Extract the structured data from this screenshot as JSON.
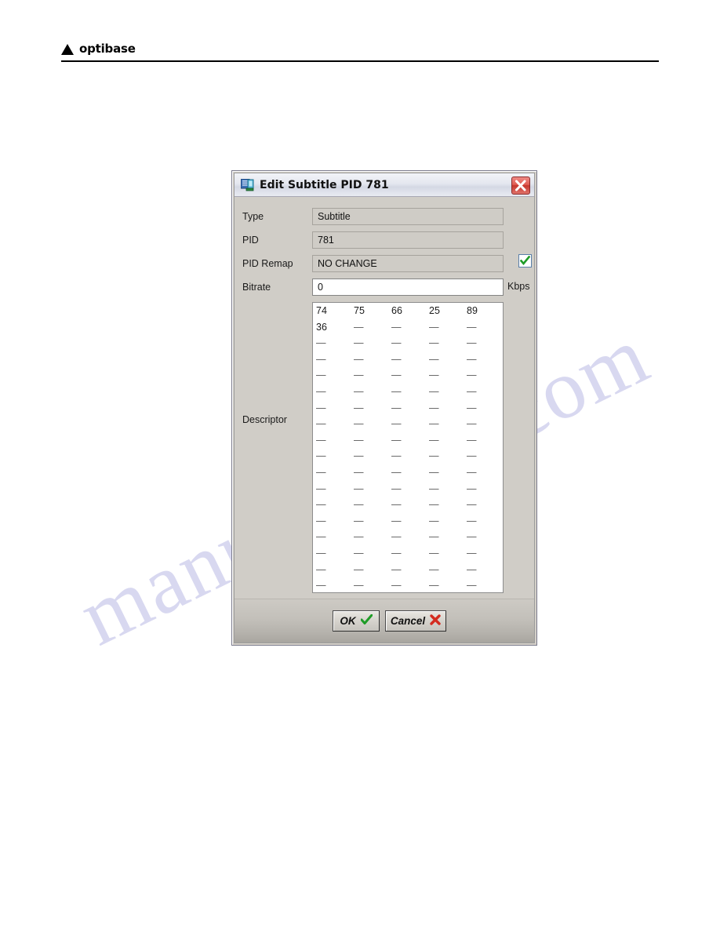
{
  "page": {
    "brand": "optibase",
    "watermark_line1": "manualshive.com",
    "watermark_line2": ""
  },
  "dialog": {
    "title": "Edit Subtitle PID 781",
    "title_icon": "computer-icon",
    "close_icon": "close-icon",
    "fields": {
      "type": {
        "label": "Type",
        "value": "Subtitle",
        "readonly": true
      },
      "pid": {
        "label": "PID",
        "value": "781",
        "readonly": true
      },
      "pid_remap": {
        "label": "PID Remap",
        "value": "NO CHANGE",
        "readonly": true,
        "checkbox_checked": true
      },
      "bitrate": {
        "label": "Bitrate",
        "value": "0",
        "readonly": false,
        "unit": "Kbps",
        "placeholder": ""
      }
    },
    "descriptor": {
      "label": "Descriptor",
      "columns": 5,
      "rows": [
        [
          "74",
          "75",
          "66",
          "25",
          "89"
        ],
        [
          "36",
          "—",
          "—",
          "—",
          "—"
        ],
        [
          "—",
          "—",
          "—",
          "—",
          "—"
        ],
        [
          "—",
          "—",
          "—",
          "—",
          "—"
        ],
        [
          "—",
          "—",
          "—",
          "—",
          "—"
        ],
        [
          "—",
          "—",
          "—",
          "—",
          "—"
        ],
        [
          "—",
          "—",
          "—",
          "—",
          "—"
        ],
        [
          "—",
          "—",
          "—",
          "—",
          "—"
        ],
        [
          "—",
          "—",
          "—",
          "—",
          "—"
        ],
        [
          "—",
          "—",
          "—",
          "—",
          "—"
        ],
        [
          "—",
          "—",
          "—",
          "—",
          "—"
        ],
        [
          "—",
          "—",
          "—",
          "—",
          "—"
        ],
        [
          "—",
          "—",
          "—",
          "—",
          "—"
        ],
        [
          "—",
          "—",
          "—",
          "—",
          "—"
        ],
        [
          "—",
          "—",
          "—",
          "—",
          "—"
        ],
        [
          "—",
          "—",
          "—",
          "—",
          "—"
        ],
        [
          "—",
          "—",
          "—",
          "—",
          "—"
        ],
        [
          "—",
          "—",
          "—",
          "—",
          "—"
        ]
      ]
    },
    "buttons": {
      "ok": {
        "label": "OK",
        "icon": "check-icon"
      },
      "cancel": {
        "label": "Cancel",
        "icon": "x-icon"
      }
    }
  },
  "colors": {
    "dialog_face": "#d0cdc7",
    "titlebar": "#e4e7ef",
    "close_red": "#c6352c",
    "check_green": "#1f9c27",
    "cancel_red": "#d42b1f",
    "watermark": "#b9b9e4"
  }
}
